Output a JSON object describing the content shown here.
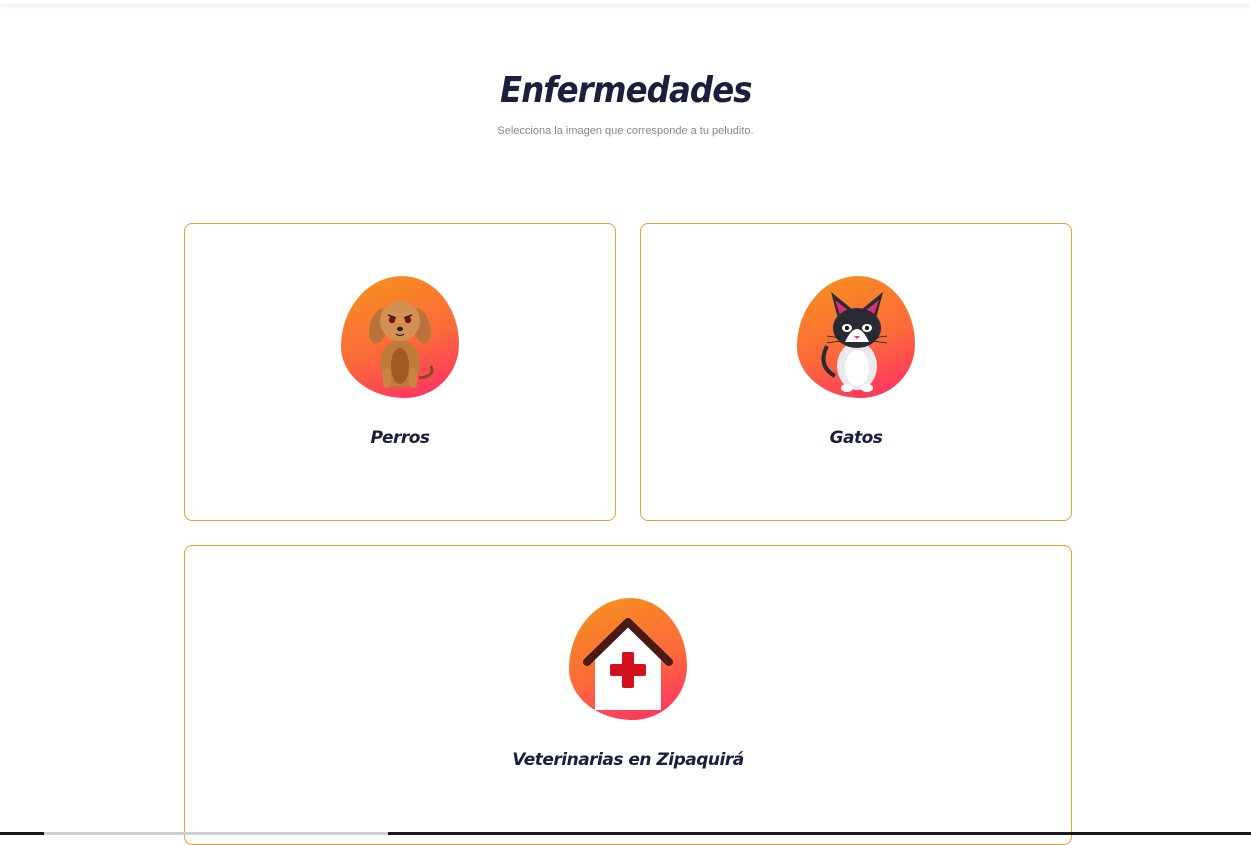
{
  "header": {
    "title": "Enfermedades",
    "subtitle": "Selecciona la imagen que corresponde a tu peludito."
  },
  "cards": [
    {
      "label": "Perros",
      "icon": "dog-icon"
    },
    {
      "label": "Gatos",
      "icon": "cat-icon"
    },
    {
      "label": "Veterinarias en Zipaquirá",
      "icon": "vet-clinic-icon"
    }
  ],
  "colors": {
    "title": "#1b1f3b",
    "card_border": "#e0a526",
    "gradient_start": "#f7941d",
    "gradient_end": "#ff2a6a"
  }
}
